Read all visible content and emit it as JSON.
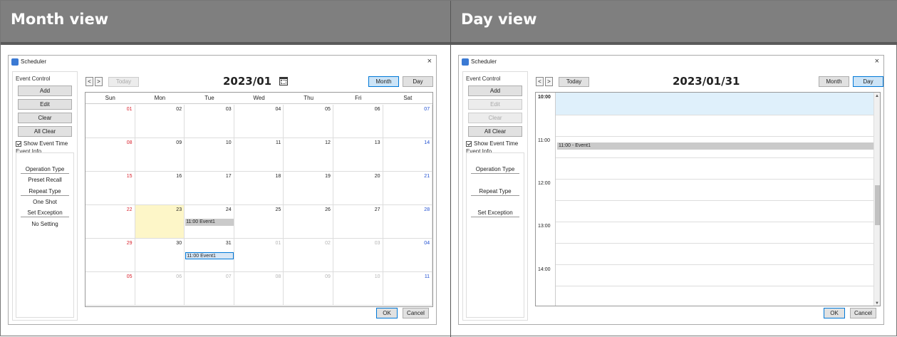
{
  "panels": {
    "month_title": "Month view",
    "day_title": "Day view"
  },
  "window": {
    "title": "Scheduler",
    "close": "×"
  },
  "left": {
    "event_control": "Event Control",
    "add": "Add",
    "edit": "Edit",
    "clear": "Clear",
    "all_clear": "All Clear",
    "show_event_time": "Show Event Time",
    "event_info": "Event Info",
    "operation_type_label": "Operation Type",
    "operation_type_value": "Preset Recall",
    "repeat_type_label": "Repeat Type",
    "repeat_type_value": "One Shot",
    "set_exception_label": "Set Exception",
    "set_exception_value": "No Setting"
  },
  "nav": {
    "prev": "<",
    "next": ">",
    "today": "Today",
    "month": "Month",
    "day": "Day"
  },
  "month": {
    "header_date": "2023/01",
    "weekdays": [
      "Sun",
      "Mon",
      "Tue",
      "Wed",
      "Thu",
      "Fri",
      "Sat"
    ],
    "weeks": [
      [
        "01",
        "02",
        "03",
        "04",
        "05",
        "06",
        "07"
      ],
      [
        "08",
        "09",
        "10",
        "11",
        "12",
        "13",
        "14"
      ],
      [
        "15",
        "16",
        "17",
        "18",
        "19",
        "20",
        "21"
      ],
      [
        "22",
        "23",
        "24",
        "25",
        "26",
        "27",
        "28"
      ],
      [
        "29",
        "30",
        "31",
        "01",
        "02",
        "03",
        "04"
      ],
      [
        "05",
        "06",
        "07",
        "08",
        "09",
        "10",
        "11"
      ]
    ],
    "event1": "11:00 Event1",
    "event2": "11:00 Event1"
  },
  "day": {
    "header_date": "2023/01/31",
    "times": [
      "10:00",
      "11:00",
      "12:00",
      "13:00",
      "14:00"
    ],
    "event": "11:00 - Event1"
  },
  "footer": {
    "ok": "OK",
    "cancel": "Cancel"
  },
  "colors": {
    "sunday": "#d9232e",
    "saturday": "#1f4fd1",
    "other_month": "#b5b5b5",
    "selected_day": "#fdf6c8",
    "now_band": "#dff0fb"
  }
}
